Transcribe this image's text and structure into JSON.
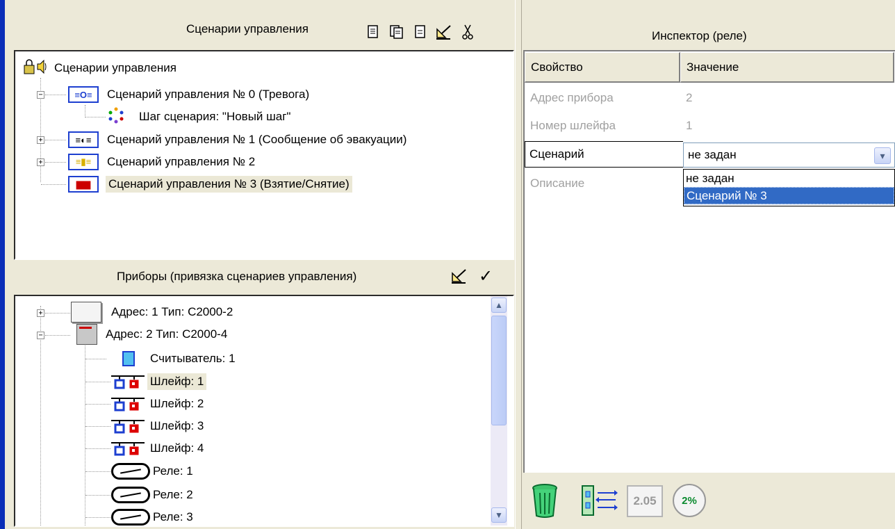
{
  "scenarios_panel": {
    "title": "Сценарии управления",
    "toolbar_icons": [
      "new-doc-icon",
      "copy-doc-icon",
      "doc-icon",
      "edit-icon",
      "cut-icon"
    ],
    "root_label": "Сценарии управления",
    "items": [
      {
        "label": "Сценарий управления № 0 (Тревога)",
        "expander": "⊟",
        "icon_text": "≡O≡"
      },
      {
        "label": "Шаг сценария: \"Новый шаг\""
      },
      {
        "label": "Сценарий управления № 1 (Сообщение об эвакуации)",
        "expander": "⊞",
        "icon_text": "≡◐≡"
      },
      {
        "label": "Сценарий управления № 2",
        "expander": "⊞",
        "icon_text": "≡▮≡"
      },
      {
        "label": "Сценарий управления № 3 (Взятие/Снятие)",
        "icon_text": "▆▆"
      }
    ]
  },
  "devices_panel": {
    "title": "Приборы  (привязка сценариев управления)",
    "check_glyph": "✓",
    "items": [
      {
        "label": "Адрес: 1 Тип: С2000-2"
      },
      {
        "label": "Адрес: 2 Тип: С2000-4"
      },
      {
        "label": "Считыватель: 1"
      },
      {
        "label": "Шлейф: 1"
      },
      {
        "label": "Шлейф: 2"
      },
      {
        "label": "Шлейф: 3"
      },
      {
        "label": "Шлейф: 4"
      },
      {
        "label": "Реле: 1"
      },
      {
        "label": "Реле: 2"
      },
      {
        "label": "Реле: 3"
      }
    ]
  },
  "inspector": {
    "title": "Инспектор (реле)",
    "col_property": "Свойство",
    "col_value": "Значение",
    "rows": [
      {
        "name": "Адрес прибора",
        "value": "2"
      },
      {
        "name": "Номер шлейфа",
        "value": "1"
      },
      {
        "name": "Сценарий",
        "value": "не задан"
      },
      {
        "name": "Описание",
        "value": ""
      }
    ],
    "dropdown_options": [
      "не задан",
      "Сценарий № 3"
    ],
    "selected_option": "Сценарий № 3"
  },
  "bottom_toolbar": {
    "version_label": "2.05",
    "percent_label": "2%"
  },
  "colors": {
    "background": "#ece9d8",
    "selection": "#316ac5",
    "accent_blue": "#1d3fd0",
    "edge_blue": "#0a2eb8"
  }
}
